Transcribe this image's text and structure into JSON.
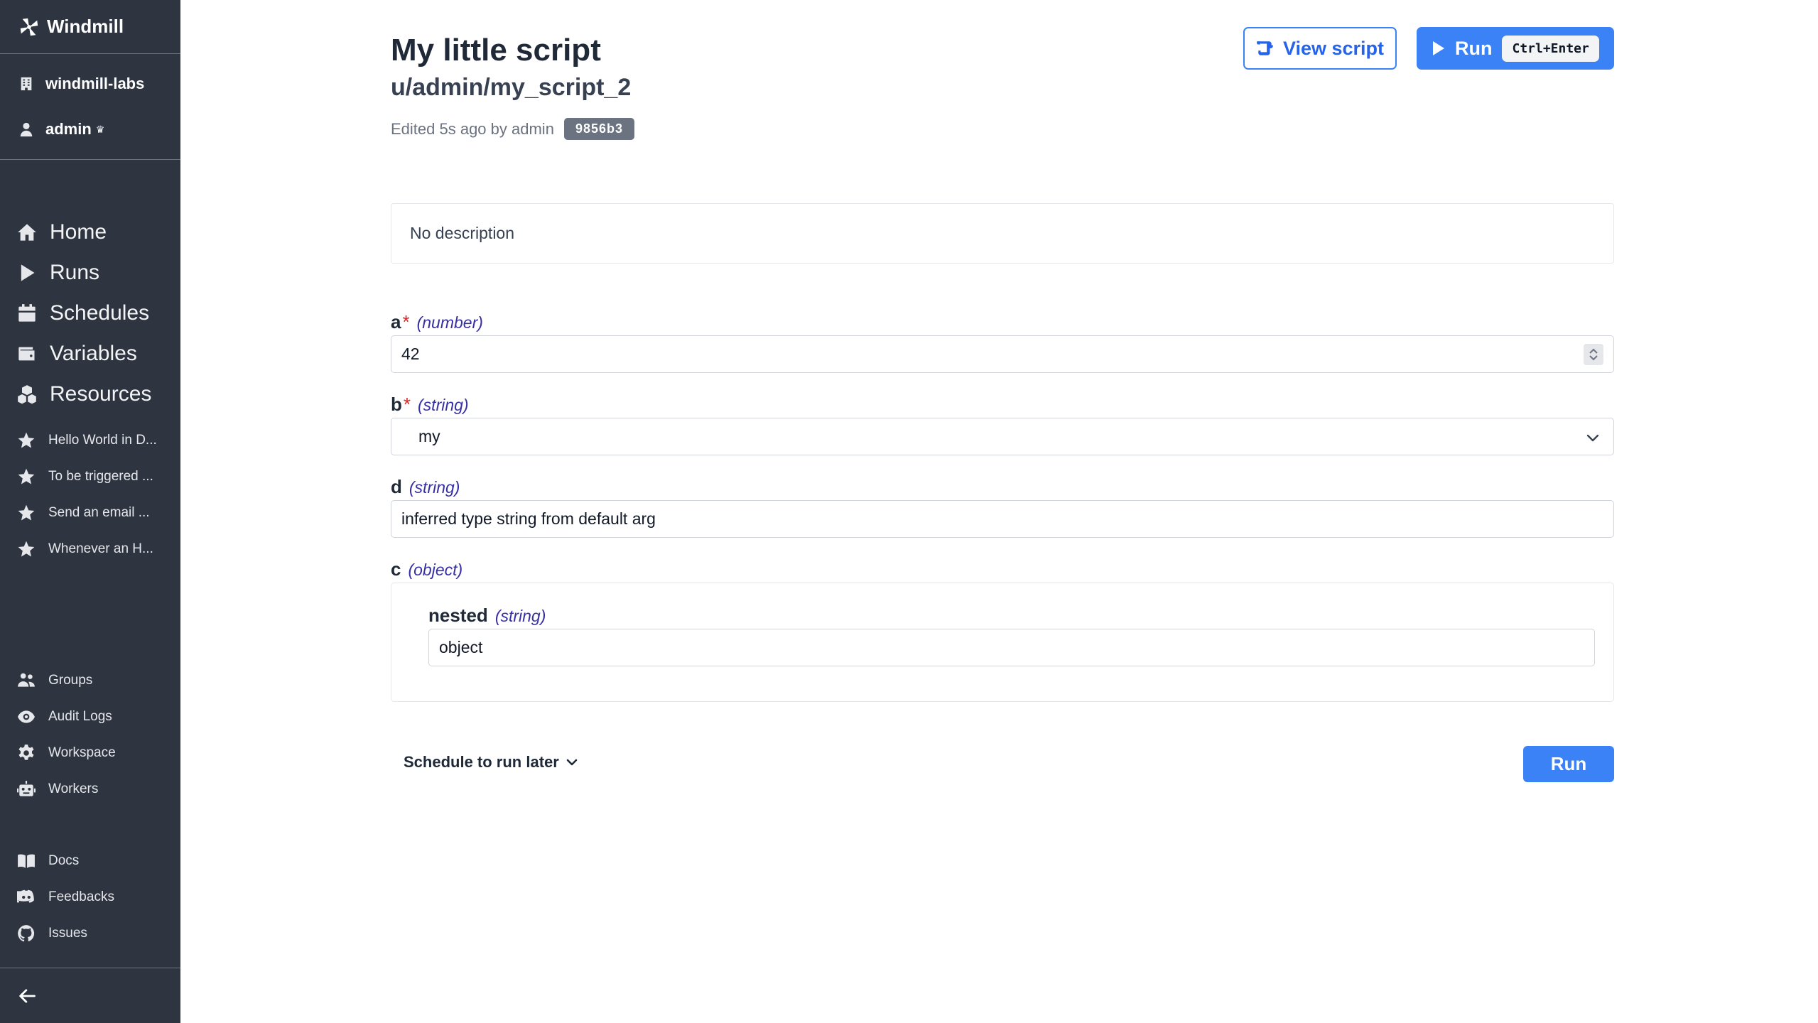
{
  "sidebar": {
    "brand": "Windmill",
    "workspace": "windmill-labs",
    "user": "admin",
    "user_badge": "♛",
    "main_nav": [
      {
        "label": "Home",
        "icon": "home-icon"
      },
      {
        "label": "Runs",
        "icon": "play-icon"
      },
      {
        "label": "Schedules",
        "icon": "calendar-icon"
      },
      {
        "label": "Variables",
        "icon": "wallet-icon"
      },
      {
        "label": "Resources",
        "icon": "cubes-icon"
      }
    ],
    "favorites": [
      {
        "label": "Hello World in D...",
        "icon": "star-icon"
      },
      {
        "label": "To be triggered ...",
        "icon": "star-icon"
      },
      {
        "label": "Send an email ...",
        "icon": "star-icon"
      },
      {
        "label": "Whenever an H...",
        "icon": "star-icon"
      }
    ],
    "admin_nav": [
      {
        "label": "Groups",
        "icon": "users-icon"
      },
      {
        "label": "Audit Logs",
        "icon": "eye-icon"
      },
      {
        "label": "Workspace",
        "icon": "gear-icon"
      },
      {
        "label": "Workers",
        "icon": "robot-icon"
      }
    ],
    "links": [
      {
        "label": "Docs",
        "icon": "book-icon"
      },
      {
        "label": "Feedbacks",
        "icon": "discord-icon"
      },
      {
        "label": "Issues",
        "icon": "github-icon"
      }
    ]
  },
  "header": {
    "title": "My little script",
    "path": "u/admin/my_script_2",
    "edited": "Edited 5s ago by admin",
    "hash": "9856b3",
    "view_script_label": "View script",
    "run_label": "Run",
    "run_shortcut": "Ctrl+Enter"
  },
  "description": "No description",
  "fields": {
    "a": {
      "name": "a",
      "required": "*",
      "type": "(number)",
      "value": "42"
    },
    "b": {
      "name": "b",
      "required": "*",
      "type": "(string)",
      "value": "my"
    },
    "d": {
      "name": "d",
      "type": "(string)",
      "value": "inferred type string from default arg"
    },
    "c": {
      "name": "c",
      "type": "(object)",
      "nested": {
        "name": "nested",
        "type": "(string)",
        "value": "object"
      }
    }
  },
  "footer": {
    "schedule_label": "Schedule to run later",
    "run_label": "Run"
  },
  "colors": {
    "sidebar_bg": "#2e3440",
    "accent": "#3b82f6",
    "type_hint": "#3730a3",
    "required": "#dc2626"
  }
}
